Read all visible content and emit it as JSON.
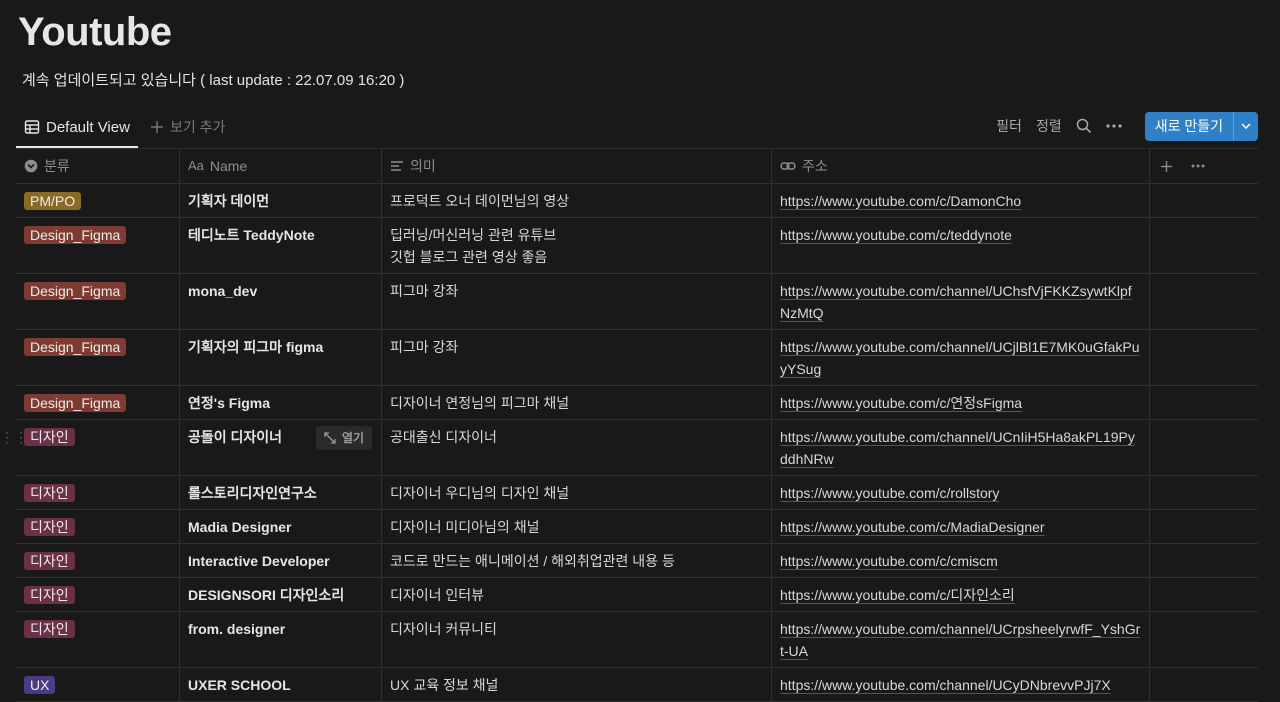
{
  "page": {
    "title": "Youtube",
    "subtitle": "계속 업데이트되고 있습니다 ( last update : 22.07.09 16:20 )"
  },
  "views": {
    "active": "Default View",
    "add_view": "보기 추가"
  },
  "toolbar": {
    "filter": "필터",
    "sort": "정렬",
    "new_button": "새로 만들기"
  },
  "table": {
    "columns": [
      "분류",
      "Name",
      "의미",
      "주소"
    ],
    "open_label": "열기",
    "rows": [
      {
        "category": "PM/PO",
        "category_color": "#8a6a25",
        "name": "기획자 데이먼",
        "meaning": "프로덕트 오너 데이먼님의 영상",
        "url": "https://www.youtube.com/c/DamonCho"
      },
      {
        "category": "Design_Figma",
        "category_color": "#7d3b31",
        "name": "테디노트 TeddyNote",
        "meaning": "딥러닝/머신러닝 관련 유튜브\n깃헙 블로그 관련 영상 좋음",
        "url": "https://www.youtube.com/c/teddynote"
      },
      {
        "category": "Design_Figma",
        "category_color": "#7d3b31",
        "name": "mona_dev",
        "meaning": "피그마 강좌",
        "url": "https://www.youtube.com/channel/UChsfVjFKKZsywtKlpfNzMtQ"
      },
      {
        "category": "Design_Figma",
        "category_color": "#7d3b31",
        "name": "기획자의 피그마 figma",
        "meaning": "피그마 강좌",
        "url": "https://www.youtube.com/channel/UCjlBl1E7MK0uGfakPuyYSug"
      },
      {
        "category": "Design_Figma",
        "category_color": "#7d3b31",
        "name": "연정's Figma",
        "meaning": "디자이너 연정님의 피그마 채널",
        "url": "https://www.youtube.com/c/연정sFigma"
      },
      {
        "category": "디자인",
        "category_color": "#6b2f47",
        "name": "공돌이 디자이너",
        "meaning": "공대출신 디자이너",
        "url": "https://www.youtube.com/channel/UCnIiH5Ha8akPL19PyddhNRw"
      },
      {
        "category": "디자인",
        "category_color": "#6b2f47",
        "name": "롤스토리디자인연구소",
        "meaning": "디자이너 우디님의 디자인 채널",
        "url": "https://www.youtube.com/c/rollstory"
      },
      {
        "category": "디자인",
        "category_color": "#6b2f47",
        "name": "Madia Designer",
        "meaning": "디자이너 미디아님의 채널",
        "url": "https://www.youtube.com/c/MadiaDesigner"
      },
      {
        "category": "디자인",
        "category_color": "#6b2f47",
        "name": "Interactive Developer",
        "meaning": "코드로 만드는 애니메이션 / 해외취업관련 내용 등",
        "url": "https://www.youtube.com/c/cmiscm"
      },
      {
        "category": "디자인",
        "category_color": "#6b2f47",
        "name": "DESIGNSORI 디자인소리",
        "meaning": "디자이너 인터뷰",
        "url": "https://www.youtube.com/c/디자인소리"
      },
      {
        "category": "디자인",
        "category_color": "#6b2f47",
        "name": "from. designer",
        "meaning": "디자이너 커뮤니티",
        "url": "https://www.youtube.com/channel/UCrpsheelyrwfF_YshGrt-UA"
      },
      {
        "category": "UX",
        "category_color": "#4b3a84",
        "name": "UXER SCHOOL",
        "meaning": "UX 교육 정보 채널",
        "url": "https://www.youtube.com/channel/UCyDNbrevvPJj7X"
      }
    ]
  }
}
